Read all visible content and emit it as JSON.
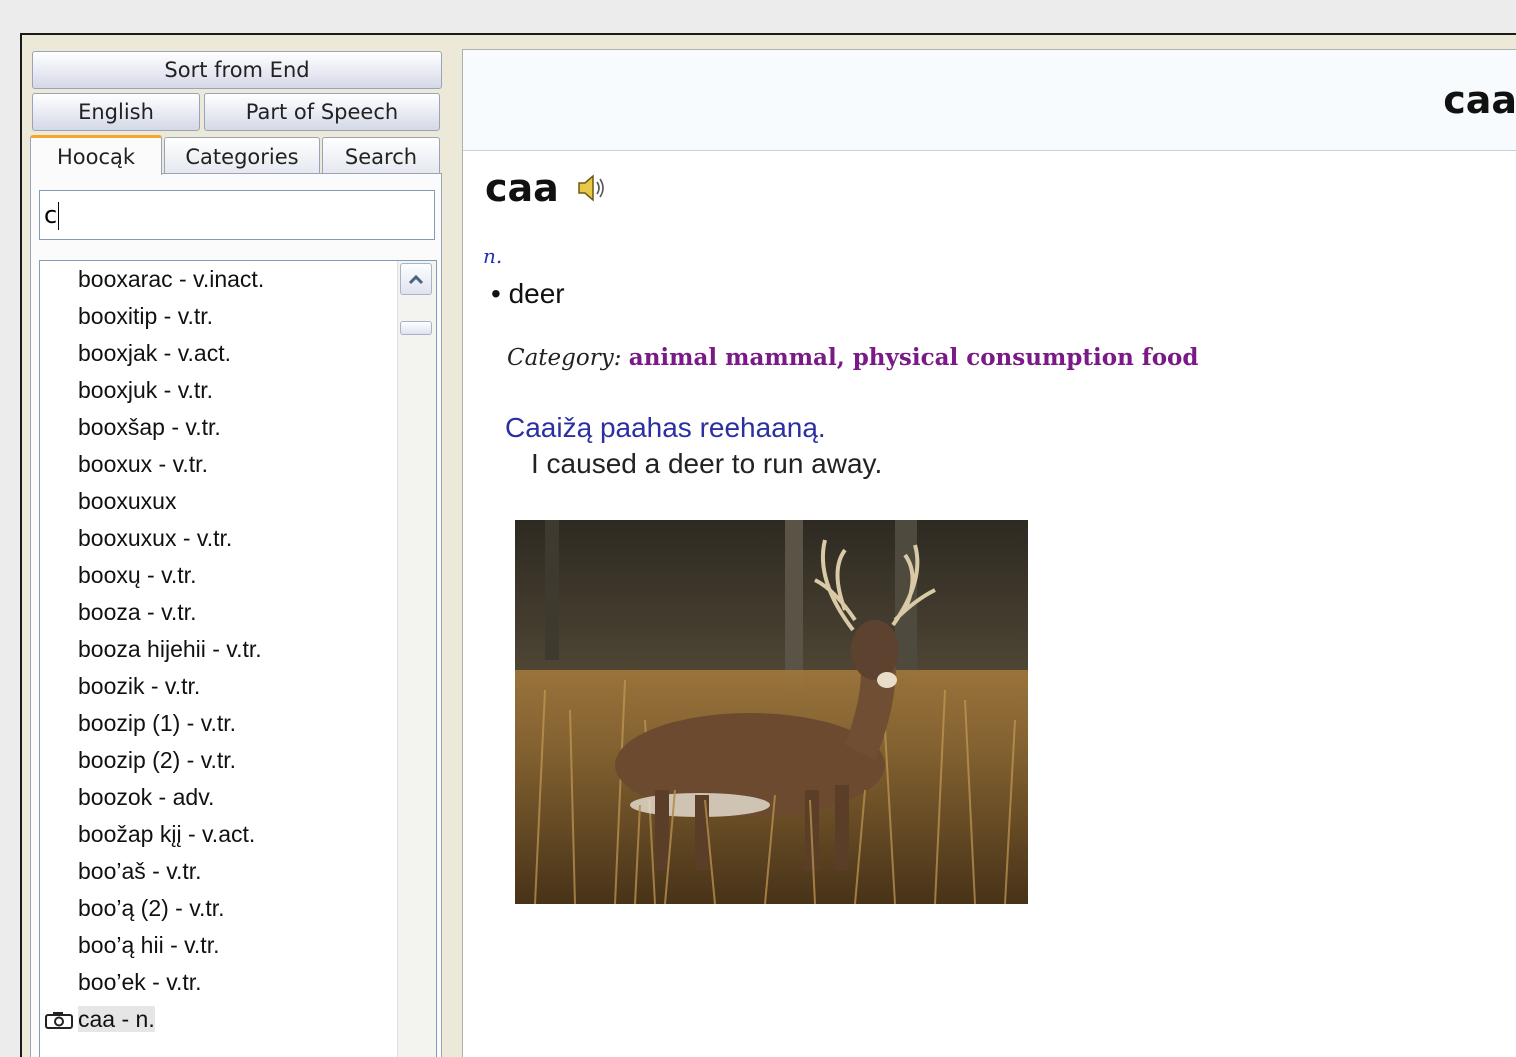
{
  "left_panel": {
    "sort_button": "Sort from End",
    "tabs_row2": [
      "English",
      "Part of Speech"
    ],
    "tabs_row1": [
      "Hoocąk",
      "Categories",
      "Search"
    ],
    "active_tab": "Hoocąk",
    "search_value": "c",
    "word_list": [
      "booxarac - v.inact.",
      "booxitip - v.tr.",
      "booxjak - v.act.",
      "booxjuk - v.tr.",
      "booxšap - v.tr.",
      "booxux - v.tr.",
      "booxuxux",
      "booxuxux - v.tr.",
      "booxų - v.tr.",
      "booza - v.tr.",
      "booza hijehii - v.tr.",
      "boozik - v.tr.",
      "boozip (1) - v.tr.",
      "boozip (2) - v.tr.",
      "boozok - adv.",
      "boožap kįį - v.act.",
      "boo’aš - v.tr.",
      "boo’ą (2) - v.tr.",
      "boo’ą hii - v.tr.",
      "boo’ek - v.tr.",
      "caa - n."
    ],
    "selected_index": 20,
    "selected_icon": "camera-icon"
  },
  "entry": {
    "header_title": "caa",
    "headword": "caa",
    "audio_icon": "speaker-icon",
    "part_of_speech": "n.",
    "gloss": "• deer",
    "category_label": "Category:",
    "categories": "animal mammal,  physical consumption food",
    "example_hocak": "Caaižą paahas reehaaną.",
    "example_english": "I caused a deer to run away.",
    "image_icon": "deer-photo"
  },
  "colors": {
    "accent_tab": "#f4a62a",
    "category": "#7a1a86",
    "example": "#2b2fa0",
    "pos": "#2233aa"
  }
}
